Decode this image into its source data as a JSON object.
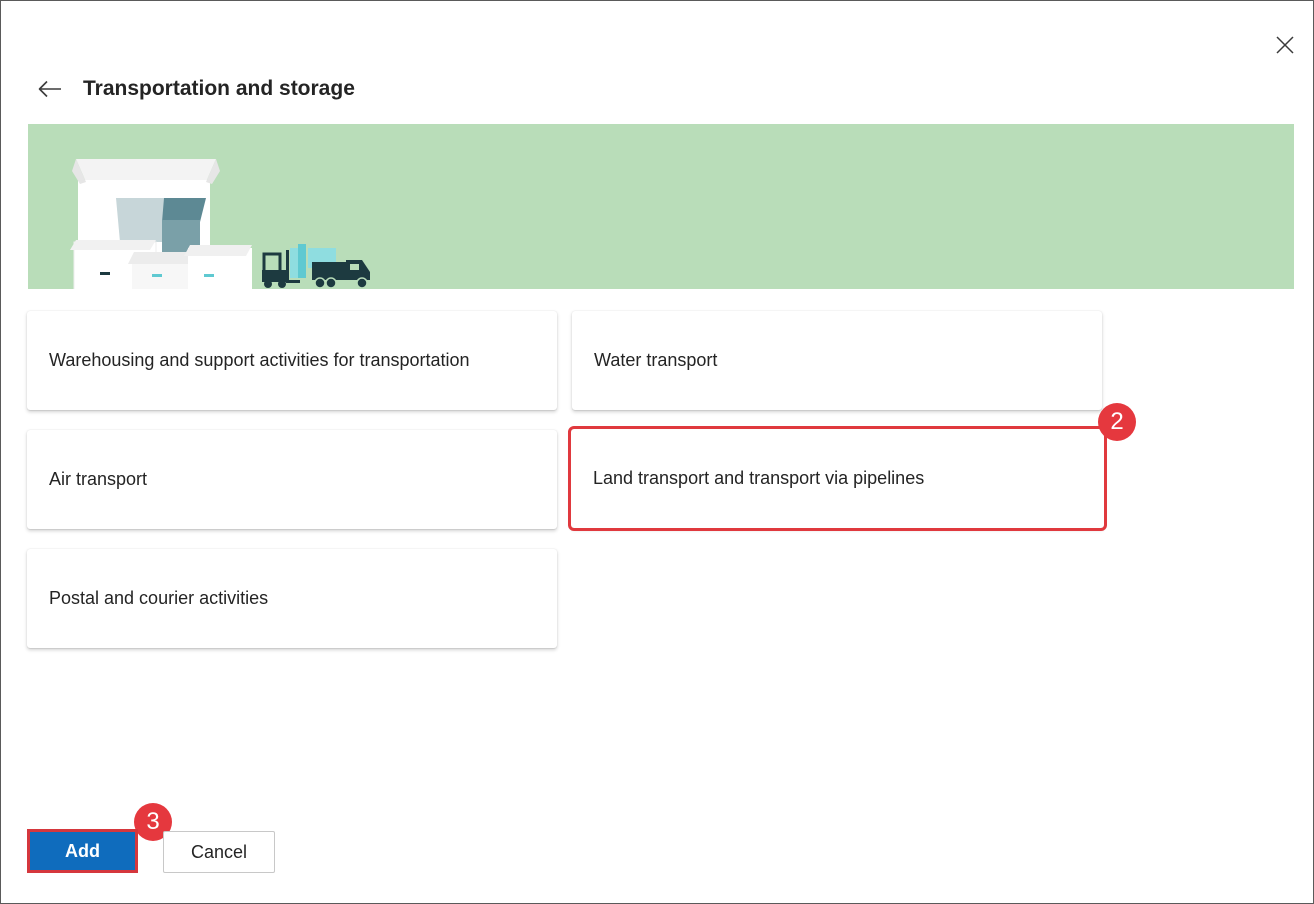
{
  "dialog": {
    "title": "Transportation and storage",
    "back_icon": "arrow-left-icon",
    "close_icon": "close-icon",
    "banner_color": "#b9ddb9",
    "banner_illustration": "warehouse-boxes-and-truck-illustration"
  },
  "cards": [
    {
      "label": "Warehousing and support activities for transportation",
      "selected": false
    },
    {
      "label": "Water transport",
      "selected": false
    },
    {
      "label": "Air transport",
      "selected": false
    },
    {
      "label": "Land transport and transport via pipelines",
      "selected": true
    },
    {
      "label": "Postal and courier activities",
      "selected": false
    }
  ],
  "markers": {
    "step2": "2",
    "step3": "3",
    "color": "#e5383e"
  },
  "footer": {
    "add_label": "Add",
    "cancel_label": "Cancel",
    "primary_color": "#0f6cbd"
  }
}
